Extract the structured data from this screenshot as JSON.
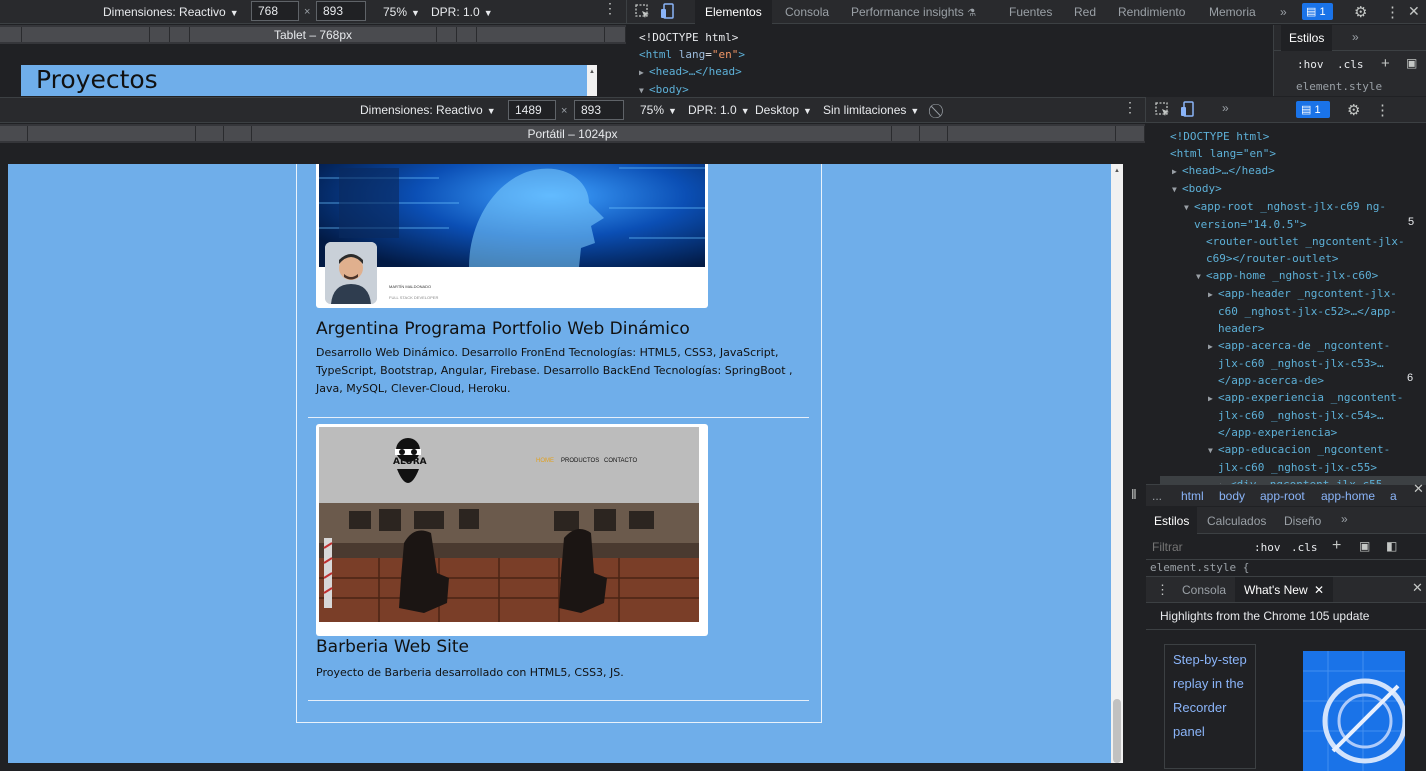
{
  "tablet_toolbar": {
    "dimensions_label": "Dimensiones: Reactivo",
    "width": "768",
    "height": "893",
    "zoom": "75%",
    "dpr": "DPR: 1.0",
    "ruler_title": "Tablet – 768px"
  },
  "tablet_page": {
    "title": "Proyectos"
  },
  "top_devtools": {
    "tabs": [
      "Elementos",
      "Consola",
      "Performance insights",
      "Fuentes",
      "Red",
      "Rendimiento",
      "Memoria"
    ],
    "more": "»",
    "issues_count": "1",
    "styles_tab": "Estilos",
    "hov": ":hov",
    "cls": ".cls",
    "element_style": "element.style",
    "dom": {
      "doctype": "<!DOCTYPE html>",
      "html_open": "<html",
      "lang_attr": "lang",
      "lang_val": "\"en\"",
      "head": "<head>…</head>",
      "body": "<body>"
    }
  },
  "laptop_toolbar": {
    "dimensions_label": "Dimensiones: Reactivo",
    "width": "1489",
    "height": "893",
    "zoom": "75%",
    "dpr": "DPR: 1.0",
    "device_type": "Desktop",
    "throttle": "Sin limitaciones",
    "ruler_title": "Portátil – 1024px"
  },
  "projects": [
    {
      "title": "Argentina Programa Portfolio Web Dinámico",
      "description": "Desarrollo Web Dinámico. Desarrollo FronEnd Tecnologías: HTML5, CSS3, JavaScript, TypeScript, Bootstrap, Angular, Firebase. Desarrollo BackEnd Tecnologías: SpringBoot , Java, MySQL, Clever-Cloud, Heroku.",
      "thumb_caption": "MARTÍN MALDONADO",
      "thumb_subcaption": "FULL STACK DEVELOPER"
    },
    {
      "title": "Barberia Web Site",
      "description": "Proyecto de Barberia desarrollado con HTML5, CSS3, JS.",
      "thumb_logo": "ALURA",
      "thumb_nav": [
        "HOME",
        "PRODUCTOS",
        "CONTACTO"
      ]
    }
  ],
  "right_devtools": {
    "issues_count": "1",
    "dom_lines": [
      {
        "indent": 0,
        "tri": "",
        "text": "<!DOCTYPE html>"
      },
      {
        "indent": 0,
        "tri": "",
        "text": "<html lang=\"en\">"
      },
      {
        "indent": 1,
        "tri": "▶",
        "text": "<head>…</head>"
      },
      {
        "indent": 1,
        "tri": "▼",
        "text": "<body>"
      },
      {
        "indent": 2,
        "tri": "▼",
        "text": "<app-root _nghost-jlx-c69 ng-"
      },
      {
        "indent": 2,
        "tri": "",
        "text": "version=\"14.0.5\">"
      },
      {
        "indent": 3,
        "tri": "",
        "text": "<router-outlet _ngcontent-jlx-"
      },
      {
        "indent": 3,
        "tri": "",
        "text": "c69></router-outlet>"
      },
      {
        "indent": 3,
        "tri": "▼",
        "text": "<app-home _nghost-jlx-c60>"
      },
      {
        "indent": 4,
        "tri": "▶",
        "text": "<app-header _ngcontent-jlx-"
      },
      {
        "indent": 4,
        "tri": "",
        "text": "c60 _nghost-jlx-c52>…</app-"
      },
      {
        "indent": 4,
        "tri": "",
        "text": "header>"
      },
      {
        "indent": 4,
        "tri": "▶",
        "text": "<app-acerca-de _ngcontent-"
      },
      {
        "indent": 4,
        "tri": "",
        "text": "jlx-c60 _nghost-jlx-c53>…"
      },
      {
        "indent": 4,
        "tri": "",
        "text": "</app-acerca-de>"
      },
      {
        "indent": 4,
        "tri": "▶",
        "text": "<app-experiencia _ngcontent-"
      },
      {
        "indent": 4,
        "tri": "",
        "text": "jlx-c60 _nghost-jlx-c54>…"
      },
      {
        "indent": 4,
        "tri": "",
        "text": "</app-experiencia>"
      },
      {
        "indent": 4,
        "tri": "▼",
        "text": "<app-educacion _ngcontent-"
      },
      {
        "indent": 4,
        "tri": "",
        "text": "jlx-c60 _nghost-jlx-c55>"
      },
      {
        "indent": 5,
        "tri": "▶",
        "text": "<div _ngcontent-jlx-c55"
      }
    ],
    "side_numbers": [
      "5",
      "6"
    ],
    "breadcrumbs": [
      "...",
      "html",
      "body",
      "app-root",
      "app-home",
      "a"
    ],
    "styles_tabs": [
      "Estilos",
      "Calculados",
      "Diseño"
    ],
    "filter_placeholder": "Filtrar",
    "hov": ":hov",
    "cls": ".cls",
    "element_style": "element.style {",
    "drawer_tabs": [
      "Consola",
      "What's New"
    ],
    "whats_new_heading": "Highlights from the Chrome 105 update",
    "whats_new_card": "Step-by-step replay in the Recorder panel"
  }
}
